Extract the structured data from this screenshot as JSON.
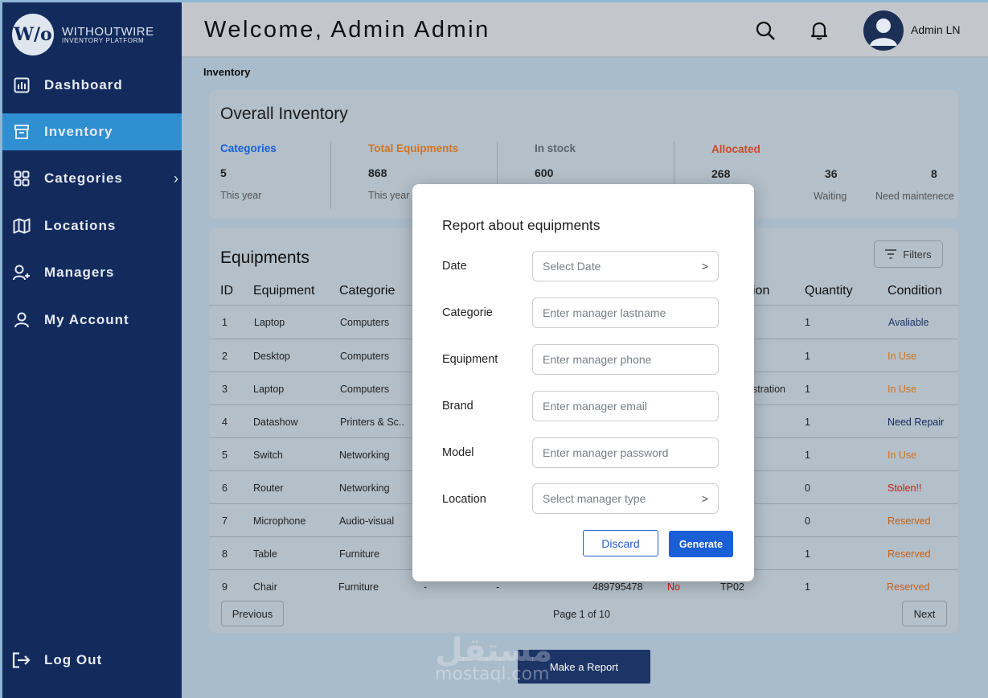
{
  "brand": {
    "logo_mark": "W/o",
    "name": "WITHOUTWIRE",
    "subtitle": "INVENTORY PLATFORM"
  },
  "sidebar": {
    "items": [
      {
        "label": "Dashboard",
        "icon": "dashboard-icon"
      },
      {
        "label": "Inventory",
        "icon": "inventory-box-icon",
        "active": true
      },
      {
        "label": "Categories",
        "icon": "grid-icon"
      },
      {
        "label": "Locations",
        "icon": "map-icon"
      },
      {
        "label": "Managers",
        "icon": "add-user-icon"
      },
      {
        "label": "My Account",
        "icon": "user-icon"
      }
    ],
    "logout": "Log Out"
  },
  "header": {
    "welcome": "Welcome, Admin Admin",
    "user": "Admin LN"
  },
  "breadcrumb": "Inventory",
  "overall": {
    "title": "Overall Inventory",
    "categories": {
      "label": "Categories",
      "value": "5",
      "sub": "This year"
    },
    "total": {
      "label": "Total Equipments",
      "value": "868",
      "sub": "This year"
    },
    "instock": {
      "label": "In stock",
      "value": "600"
    },
    "allocated": {
      "label": "Allocated",
      "value": "268"
    },
    "waiting": {
      "value": "36",
      "sub": "Waiting"
    },
    "maint": {
      "value": "8",
      "sub": "Need maintenece"
    }
  },
  "equipments": {
    "title": "Equipments",
    "filters": "Filters",
    "headers": {
      "id": "ID",
      "equipment": "Equipment",
      "categorie": "Categorie",
      "location_frag": "ion",
      "quantity": "Quantity",
      "condition": "Condition"
    },
    "rows": [
      {
        "id": "1",
        "equipment": "Laptop",
        "categorie": "Computers",
        "location": "",
        "quantity": "1",
        "condition": "Avaliable"
      },
      {
        "id": "2",
        "equipment": "Desktop",
        "categorie": "Computers",
        "location": "",
        "quantity": "1",
        "condition": "In Use"
      },
      {
        "id": "3",
        "equipment": "Laptop",
        "categorie": "Computers",
        "location": "stration",
        "quantity": "1",
        "condition": "In Use"
      },
      {
        "id": "4",
        "equipment": "Datashow",
        "categorie": "Printers & Sc..",
        "location": "",
        "quantity": "1",
        "condition": "Need Repair"
      },
      {
        "id": "5",
        "equipment": "Switch",
        "categorie": "Networking",
        "location": "",
        "quantity": "1",
        "condition": "In Use"
      },
      {
        "id": "6",
        "equipment": "Router",
        "categorie": "Networking",
        "location": "",
        "quantity": "0",
        "condition": "Stolen!!"
      },
      {
        "id": "7",
        "equipment": "Microphone",
        "categorie": "Audio-visual",
        "location": "",
        "quantity": "0",
        "condition": "Reserved"
      },
      {
        "id": "8",
        "equipment": "Table",
        "categorie": "Furniture",
        "location": "",
        "quantity": "1",
        "condition": "Reserved"
      },
      {
        "id": "9",
        "equipment": "Chair",
        "categorie": "Furniture",
        "brand": "-",
        "model": "-",
        "serial": "489795478",
        "warranty": "No",
        "location": "TP02",
        "quantity": "1",
        "condition": "Reserved"
      }
    ],
    "previous": "Previous",
    "page": "Page 1 of 10",
    "next": "Next"
  },
  "make_report": "Make a Report",
  "modal": {
    "title": "Report about equipments",
    "fields": [
      {
        "label": "Date",
        "placeholder": "Select Date",
        "suffix": ">"
      },
      {
        "label": "Categorie",
        "placeholder": "Enter manager lastname"
      },
      {
        "label": "Equipment",
        "placeholder": "Enter manager phone"
      },
      {
        "label": "Brand",
        "placeholder": "Enter manager email"
      },
      {
        "label": "Model",
        "placeholder": "Enter manager password"
      },
      {
        "label": "Location",
        "placeholder": "Select manager type",
        "suffix": ">"
      }
    ],
    "discard": "Discard",
    "generate": "Generate"
  },
  "watermark": {
    "arabic": "مستقل",
    "latin": "mostaql.com"
  },
  "colors": {
    "sidebar": "#132a5c",
    "active": "#2f8fd0",
    "primary": "#1a5fd6",
    "available": "#1c3466",
    "in_use": "#d4731e",
    "need_repair": "#132a5c",
    "stolen": "#c81e1e",
    "reserved": "#c0621f"
  }
}
